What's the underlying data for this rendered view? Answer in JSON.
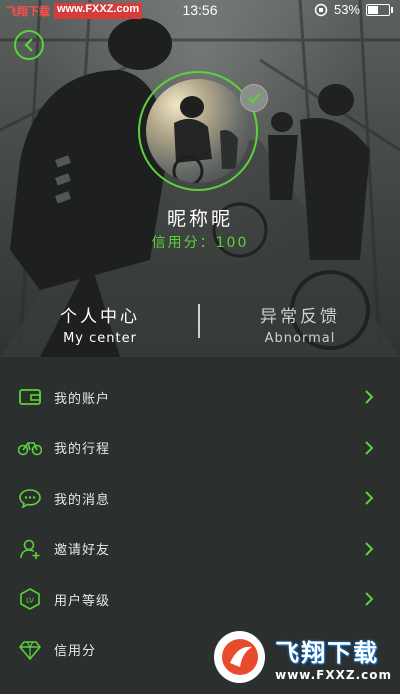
{
  "status_bar": {
    "site_tag": "飞翔下载",
    "site_url": "www.FXXZ.com",
    "time": "13:56",
    "battery_percent_label": "53%",
    "battery_level": 0.53
  },
  "profile": {
    "nickname": "昵称昵",
    "credit_label": "信用分：100"
  },
  "tabs": [
    {
      "label_cn": "个人中心",
      "label_en": "My center"
    },
    {
      "label_cn": "异常反馈",
      "label_en": "Abnormal"
    }
  ],
  "menu": {
    "items": [
      {
        "label": "我的账户",
        "icon": "wallet-icon"
      },
      {
        "label": "我的行程",
        "icon": "bicycle-icon"
      },
      {
        "label": "我的消息",
        "icon": "message-icon"
      },
      {
        "label": "邀请好友",
        "icon": "invite-user-icon"
      },
      {
        "label": "用户等级",
        "icon": "level-badge-icon"
      },
      {
        "label": "信用分",
        "icon": "diamond-icon"
      }
    ]
  },
  "watermark": {
    "title": "飞翔下载",
    "url": "www.FXXZ.com"
  },
  "colors": {
    "accent": "#5bd23b",
    "background": "#2b2f2e"
  }
}
